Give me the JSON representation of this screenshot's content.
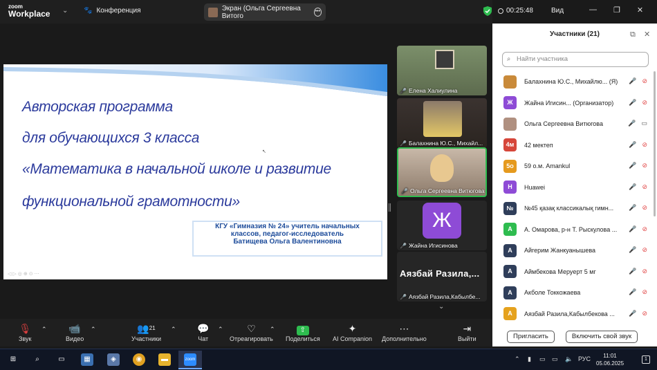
{
  "app": {
    "logo_line1": "zoom",
    "logo_line2": "Workplace",
    "conference_label": "Конференция"
  },
  "screen_share": {
    "label": "Экран (Ольга Сергеевна Витого"
  },
  "header": {
    "timer": "00:25:48",
    "view_label": "Вид"
  },
  "slide": {
    "lines": [
      "Авторская программа",
      "для  обучающихся 3 класса",
      "«Математика в начальной школе и развитие",
      "функциональной грамотности»"
    ],
    "info": [
      "КГУ «Гимназия № 24» учитель начальных",
      "классов, педагог-исследователь",
      "Батищева Ольга Валентиновна"
    ]
  },
  "tiles": [
    {
      "name": "Елена Халиулина"
    },
    {
      "name": "Балахнина Ю.С., Михайл..."
    },
    {
      "name": "Ольга Сергеевна Витюгова"
    },
    {
      "name": "Жайна Игисинова",
      "initial": "Ж"
    },
    {
      "name": "Аязбай Разила,Кабылбе...",
      "big_name": "Аязбай Разила,..."
    }
  ],
  "panel": {
    "title": "Участники (21)",
    "search_placeholder": "Найти участника",
    "invite": "Пригласить",
    "unmute": "Включить свой звук",
    "participants": [
      {
        "name": "Балахнина Ю.С., Михайлю... (Я)",
        "initial": "",
        "color": "#c98a3a"
      },
      {
        "name": "Жайна Игисин... (Организатор)",
        "initial": "Ж",
        "color": "#8e4bd6"
      },
      {
        "name": "Ольга Сергеевна Витюгова",
        "initial": "",
        "color": "#b09080"
      },
      {
        "name": "42 мектеп",
        "initial": "4м",
        "color": "#d6463a"
      },
      {
        "name": "59 о.м. Amankul",
        "initial": "5o",
        "color": "#e59a1e"
      },
      {
        "name": "Huawei",
        "initial": "H",
        "color": "#8e4bd6"
      },
      {
        "name": "№45 қазақ классикалық гимн...",
        "initial": "№",
        "color": "#2f3e5a"
      },
      {
        "name": "А. Омарова, р-н Т. Рыскулова ...",
        "initial": "А",
        "color": "#2ebc4f"
      },
      {
        "name": "Айгерим Жанкуанышева",
        "initial": "А",
        "color": "#2f3e5a"
      },
      {
        "name": "Аймбекова Меруерт 5 мг",
        "initial": "А",
        "color": "#2f3e5a"
      },
      {
        "name": "Акболе Токкожаева",
        "initial": "А",
        "color": "#2f3e5a"
      },
      {
        "name": "Аязбай Разила,Кабылбекова ...",
        "initial": "А",
        "color": "#e5a21e"
      }
    ]
  },
  "toolbar": {
    "audio": "Звук",
    "video": "Видео",
    "participants": "Участники",
    "participants_count": "21",
    "chat": "Чат",
    "react": "Отреагировать",
    "share": "Поделиться",
    "ai": "AI Companion",
    "more": "Дополнительно",
    "leave": "Выйти"
  },
  "taskbar": {
    "lang": "РУС",
    "time": "11:01",
    "date": "05.06.2025",
    "zoom_label": "zoom",
    "notifications": "1"
  }
}
